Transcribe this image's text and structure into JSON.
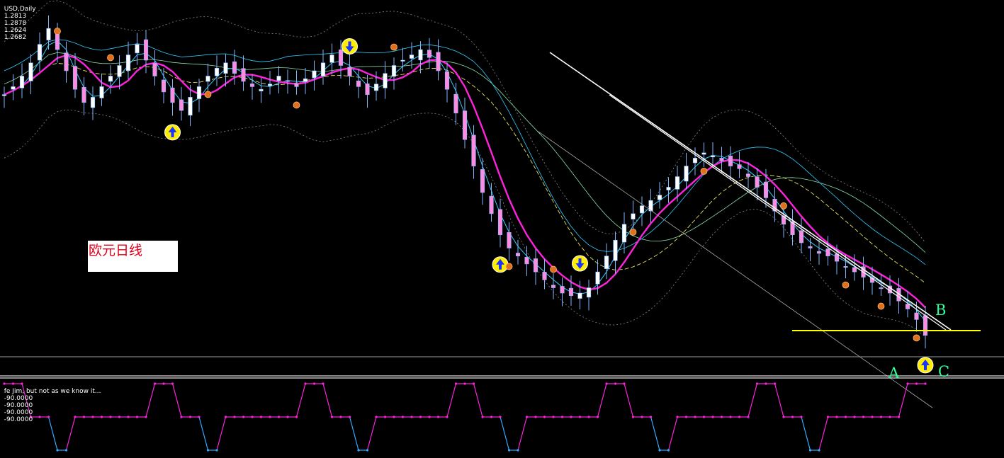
{
  "header": {
    "symbol": "USD,Daily",
    "ohlc": [
      "1.2813",
      "1.2878",
      "1.2624",
      "1.2682"
    ]
  },
  "indicator": {
    "name": "fe Jim, but not as we know it...",
    "values": [
      "-90.0000",
      "-90.0000",
      "-90.0000",
      "-90.0000"
    ]
  },
  "annotation_box": "欧元日线",
  "labels": {
    "A": "A",
    "B": "B",
    "C": "C"
  },
  "colors": {
    "bull_candle": "#ffffff",
    "bear_candle": "#ff8ce0",
    "wick": "#7fb6ff",
    "ma_fast": "#33ccff",
    "ma_mid": "#ff22dd",
    "ma_slow": "#e8e060",
    "ma_slow2": "#88ddaa",
    "envelope": "#888888",
    "trendline": "#ffffff",
    "support_line": "#ffff00",
    "label_ab": "#33ff99",
    "ind_up": "#33aaff",
    "ind_down": "#ff22dd"
  },
  "chart_data": {
    "type": "line",
    "x_ticks": [],
    "series": [
      {
        "values": [
          1.353,
          1.356,
          1.36,
          1.365,
          1.372,
          1.378,
          1.37,
          1.362,
          1.355,
          1.35,
          1.352,
          1.356,
          1.36,
          1.364,
          1.368,
          1.372,
          1.366,
          1.36,
          1.354,
          1.35,
          1.347,
          1.352,
          1.356,
          1.36,
          1.363,
          1.365,
          1.361,
          1.358,
          1.356,
          1.355,
          1.357,
          1.36,
          1.358,
          1.356,
          1.359,
          1.362,
          1.365,
          1.368,
          1.364,
          1.36,
          1.356,
          1.353,
          1.357,
          1.361,
          1.364,
          1.366,
          1.368,
          1.37,
          1.367,
          1.362,
          1.355,
          1.346,
          1.336,
          1.326,
          1.316,
          1.308,
          1.3,
          1.295,
          1.292,
          1.289,
          1.286,
          1.283,
          1.28,
          1.278,
          1.277,
          1.278,
          1.28,
          1.286,
          1.292,
          1.298,
          1.304,
          1.308,
          1.311,
          1.313,
          1.315,
          1.318,
          1.322,
          1.326,
          1.329,
          1.331,
          1.33,
          1.328,
          1.326,
          1.325,
          1.322,
          1.318,
          1.314,
          1.309,
          1.304,
          1.3,
          1.297,
          1.295,
          1.293,
          1.292,
          1.29,
          1.288,
          1.286,
          1.284,
          1.282,
          1.28,
          1.278,
          1.275,
          1.272,
          1.268,
          1.262
        ]
      }
    ],
    "ylim": [
      1.255,
      1.385
    ]
  }
}
